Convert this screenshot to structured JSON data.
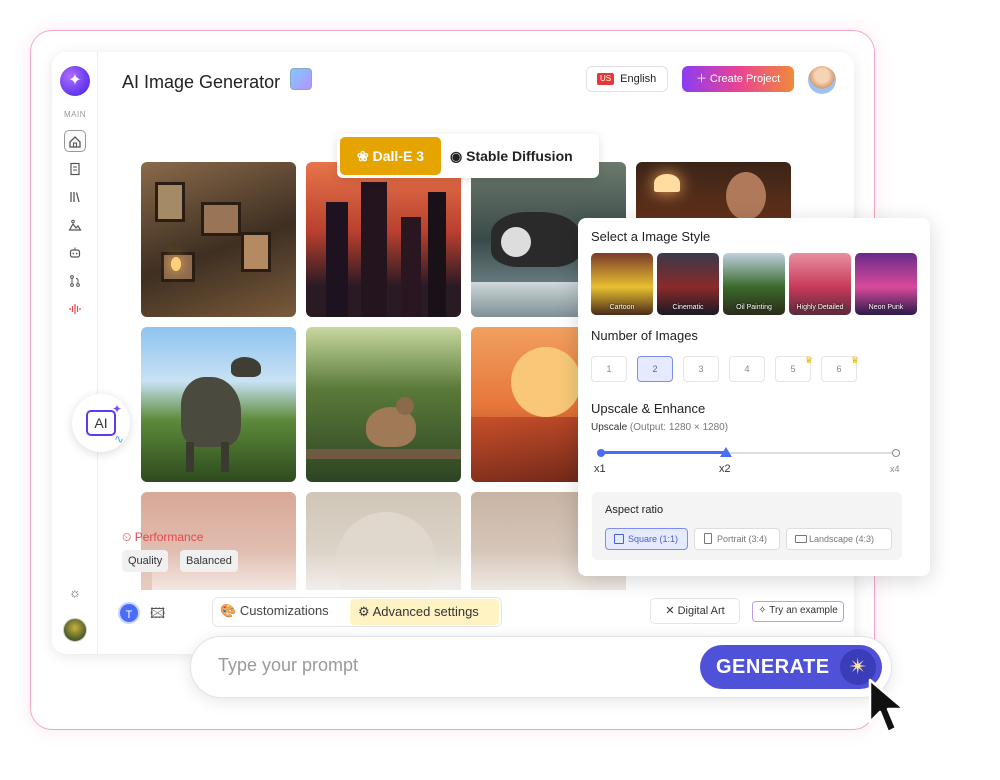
{
  "app": {
    "title": "AI Image Generator",
    "logo_icon": "spiral-logo-icon",
    "accent": "#4f52d8"
  },
  "sidebar": {
    "section_label": "MAIN",
    "items": [
      {
        "name": "home",
        "icon": "home-icon"
      },
      {
        "name": "documents",
        "icon": "document-icon"
      },
      {
        "name": "library",
        "icon": "library-icon"
      },
      {
        "name": "images",
        "icon": "image-icon"
      },
      {
        "name": "bot",
        "icon": "robot-icon"
      },
      {
        "name": "workflow",
        "icon": "branch-icon"
      },
      {
        "name": "audio",
        "icon": "audio-wave-icon"
      }
    ]
  },
  "header": {
    "language": {
      "flag": "US",
      "label": "English"
    },
    "create_project": "Create Project"
  },
  "models": {
    "active": "Dall-E 3",
    "other": "Stable Diffusion"
  },
  "performance": {
    "label": "Performance",
    "options": [
      "Quality",
      "Balanced"
    ]
  },
  "style_panel": {
    "style_heading": "Select a Image Style",
    "styles": [
      "Cartoon",
      "Cinematic",
      "Oil Painting",
      "Highly Detailed",
      "Neon Punk"
    ],
    "number_heading": "Number of Images",
    "numbers": [
      "1",
      "2",
      "3",
      "4",
      "5",
      "6"
    ],
    "selected_number": "2",
    "premium_numbers": [
      "5",
      "6"
    ],
    "upscale_heading": "Upscale & Enhance",
    "upscale_label": "Upscale",
    "upscale_output": "(Output: 1280 × 1280)",
    "slider_labels": [
      "x1",
      "x2",
      "x4"
    ],
    "slider_value": "x2",
    "aspect_heading": "Aspect ratio",
    "aspects": [
      "Square (1:1)",
      "Portrait (3:4)",
      "Landscape (4:3)"
    ],
    "selected_aspect": "Square (1:1)"
  },
  "toolbar": {
    "text_mode": "T",
    "customizations": "Customizations",
    "advanced": "Advanced settings",
    "tag": "Digital Art",
    "try_example": "Try an example"
  },
  "prompt": {
    "placeholder": "Type your prompt",
    "generate": "GENERATE"
  },
  "ai_badge": "AI"
}
